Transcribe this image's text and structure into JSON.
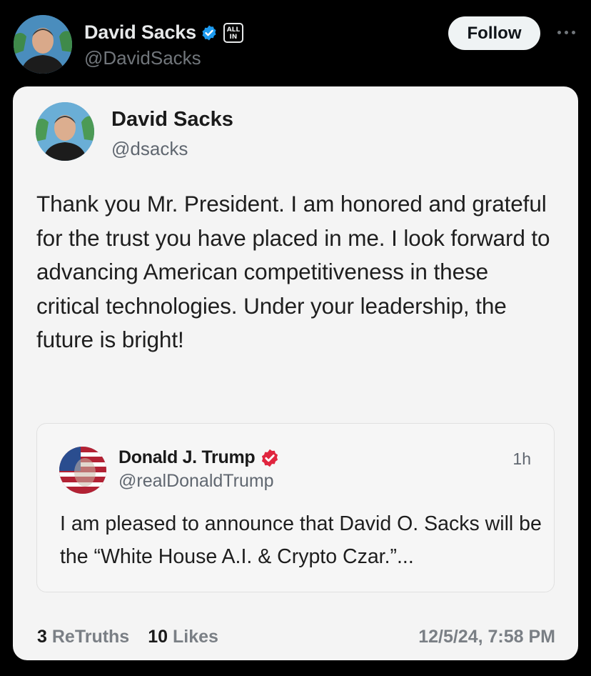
{
  "header": {
    "name": "David Sacks",
    "handle": "@DavidSacks",
    "affiliate_badge": "ALL IN",
    "follow_label": "Follow",
    "verified_color": "#1d9bf0"
  },
  "truth": {
    "name": "David Sacks",
    "handle": "@dsacks",
    "text": "Thank you Mr. President. I am honored and grateful for the trust you have placed in me. I look forward to advancing American competitiveness in these critical technologies. Under your leadership, the future is bright!",
    "quote": {
      "name": "Donald J. Trump",
      "handle": "@realDonaldTrump",
      "time": "1h",
      "text": "I am pleased to announce that David O. Sacks will be the “White House A.I. & Crypto Czar.”...",
      "verified_color": "#e0253e"
    },
    "stats": {
      "retruths_count": "3",
      "retruths_label": "ReTruths",
      "likes_count": "10",
      "likes_label": "Likes",
      "timestamp": "12/5/24, 7:58 PM"
    }
  },
  "icons": {
    "header_verified": "verified-badge-icon",
    "more": "more-options-icon",
    "quote_verified": "verified-badge-icon"
  }
}
